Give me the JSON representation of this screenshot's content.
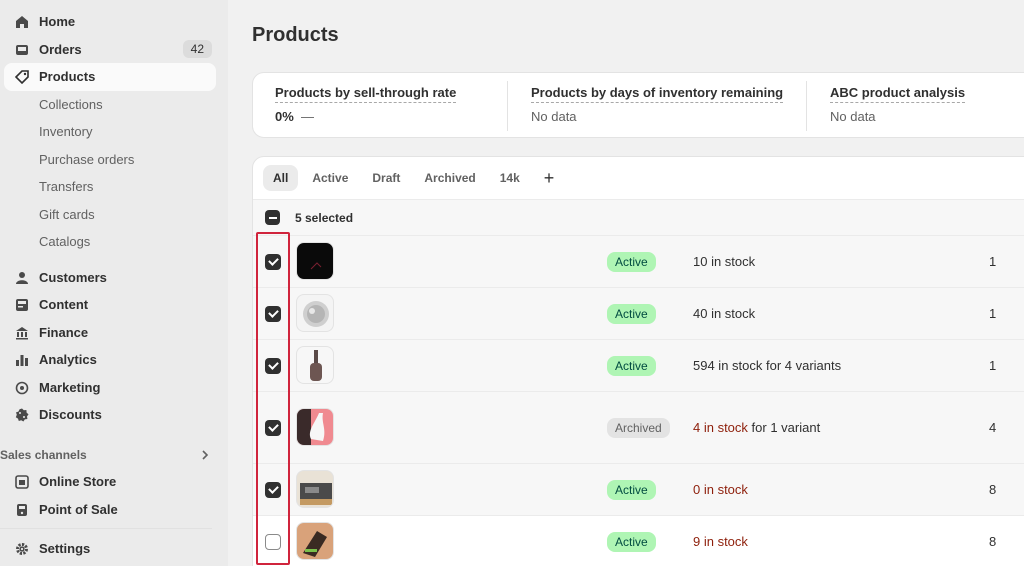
{
  "sidebar": {
    "items": [
      {
        "label": "Home",
        "icon": "home-icon"
      },
      {
        "label": "Orders",
        "icon": "inbox-icon",
        "badge": "42"
      },
      {
        "label": "Products",
        "icon": "tag-icon",
        "active": true
      },
      {
        "label": "Collections",
        "sub": true
      },
      {
        "label": "Inventory",
        "sub": true
      },
      {
        "label": "Purchase orders",
        "sub": true
      },
      {
        "label": "Transfers",
        "sub": true
      },
      {
        "label": "Gift cards",
        "sub": true
      },
      {
        "label": "Catalogs",
        "sub": true
      },
      {
        "label": "Customers",
        "icon": "person-icon"
      },
      {
        "label": "Content",
        "icon": "content-icon"
      },
      {
        "label": "Finance",
        "icon": "bank-icon"
      },
      {
        "label": "Analytics",
        "icon": "bar-chart-icon"
      },
      {
        "label": "Marketing",
        "icon": "target-icon"
      },
      {
        "label": "Discounts",
        "icon": "discount-icon"
      }
    ],
    "sales_channels_label": "Sales channels",
    "channels": [
      {
        "label": "Online Store",
        "icon": "store-icon"
      },
      {
        "label": "Point of Sale",
        "icon": "pos-icon"
      }
    ],
    "settings_label": "Settings"
  },
  "page": {
    "title": "Products"
  },
  "metrics": [
    {
      "title": "Products by sell-through rate",
      "value": "0%",
      "extra": "—"
    },
    {
      "title": "Products by days of inventory remaining",
      "value": "No data"
    },
    {
      "title": "ABC product analysis",
      "value": "No data"
    }
  ],
  "tabs": [
    "All",
    "Active",
    "Draft",
    "Archived",
    "14k",
    "+"
  ],
  "bulk": {
    "label": "5 selected"
  },
  "rows": [
    {
      "checked": true,
      "status": "Active",
      "inventory_low": "",
      "inventory": "10 in stock",
      "count": "1"
    },
    {
      "checked": true,
      "status": "Active",
      "inventory_low": "",
      "inventory": "40 in stock",
      "count": "1"
    },
    {
      "checked": true,
      "status": "Active",
      "inventory_low": "",
      "inventory": "594 in stock for 4 variants",
      "count": "1"
    },
    {
      "checked": true,
      "status": "Archived",
      "inventory_low": "4 in stock",
      "inventory": " for 1 variant",
      "count": "4"
    },
    {
      "checked": true,
      "status": "Active",
      "inventory_low": "0 in stock",
      "inventory": "",
      "count": "8"
    },
    {
      "checked": false,
      "status": "Active",
      "inventory_low": "9 in stock",
      "inventory": "",
      "count": "8"
    }
  ],
  "colors": {
    "accent": "#303030",
    "status_active_bg": "#aff5b4",
    "low_stock": "#8e1f0b",
    "highlight": "#d0243c"
  }
}
